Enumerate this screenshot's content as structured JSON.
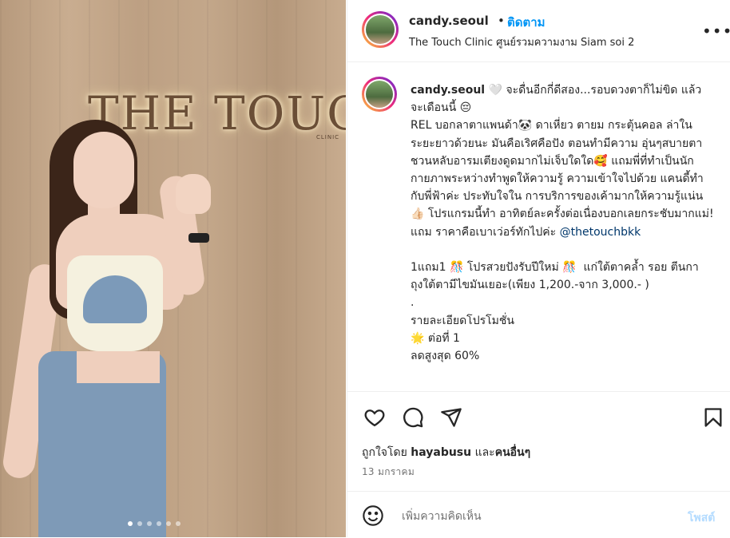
{
  "post": {
    "photo": {
      "sign_text": "THE TOUCH",
      "sign_small": "CLINIC",
      "carousel_count": 6,
      "carousel_active": 0
    },
    "header": {
      "username": "candy.seoul",
      "separator": "•",
      "follow_label": "ติดตาม",
      "location": "The Touch Clinic ศูนย์รวมความงาม Siam soi 2",
      "more_icon": "more-horizontal-icon"
    },
    "caption": {
      "username": "candy.seoul",
      "part1": " 🤍 จะดื่นอีกกี่ดีสอง...รอบดวงตาก็ไม่ขิด แล้วจะเดือนนี้ 😔\nREL บอกลาตาแพนด้า🐼 ดาเหี่ยว ตายม กระตุ้นคอล ล่าในระยะยาวด้วยนะ มันคือเริศคือปัง ตอนทำมีความ อุ่นๆสบายตาชวนหลับอารมเตียงดูดมากไม่เจ็บใดใด🥰 แถมพี่ที่ทำเป็นนักกายภาพระหว่างทำพูดให้ความรู้ ความเข้าใจไปด้วย แคนดี้ทำกับพี่ฟ้าค่ะ ประทับใจใน การบริการของเค้ามากให้ความรู้แน่น 👍🏻 โปรแกรมนี้ทำ อาทิตย์ละครั้งต่อเนื่องบอกเลยกระชับมากแม่! แถม ราคาคือเบาเว่อร์ทักไปค่ะ ",
      "mention": "@thetouchbkk",
      "part2": "\n\n1แถม1 🎊 โปรสวยปังรับปีใหม่ 🎊  แก่ใต้ตาคล้ำ รอย ตีนกา ถุงใต้ตามีไขมันเยอะ(เพียง 1,200.-จาก 3,000.- )\n.\nรายละเอียดโปรโมชั่น\n🌟 ต่อที่ 1\nลดสูงสุด 60%"
    },
    "actions": {
      "like_icon": "heart-icon",
      "comment_icon": "comment-icon",
      "share_icon": "share-icon",
      "save_icon": "bookmark-icon"
    },
    "likes": {
      "prefix": "ถูกใจโดย",
      "user": "hayabusu",
      "conj": "และ",
      "others": "คนอื่นๆ"
    },
    "date": "13 มกราคม",
    "comment": {
      "emoji_icon": "emoji-icon",
      "placeholder": "เพิ่มความคิดเห็น",
      "value": "",
      "post_label": "โพสต์"
    }
  },
  "colors": {
    "link_blue": "#0095f6",
    "mention": "#00376b",
    "text": "#262626",
    "muted": "#737373",
    "post_disabled": "#b3dbff"
  }
}
